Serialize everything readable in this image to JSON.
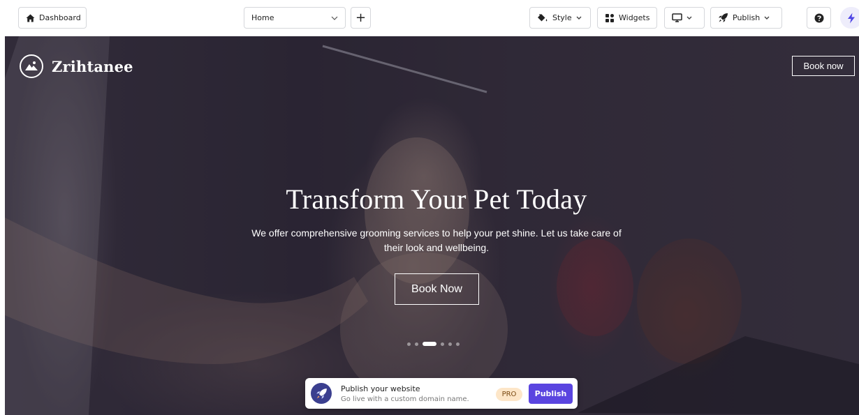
{
  "toolbar": {
    "dashboard_label": "Dashboard",
    "page_select_value": "Home",
    "add_page_label": "+",
    "style_label": "Style",
    "widgets_label": "Widgets",
    "publish_label": "Publish",
    "icons": [
      "home-icon",
      "chevron-down-icon",
      "plus-icon",
      "paint-bucket-icon",
      "widgets-grid-icon",
      "monitor-icon",
      "rocket-icon",
      "help-icon",
      "lightning-icon"
    ]
  },
  "site": {
    "brand_name": "Zrihtanee",
    "nav_cta": "Book now",
    "hero": {
      "title": "Transform Your Pet Today",
      "subtitle": "We offer comprehensive grooming services to help your pet shine. Let us take care of their look and wellbeing.",
      "cta": "Book Now",
      "slides_count": 6,
      "active_slide": 3
    }
  },
  "publish_banner": {
    "title": "Publish your website",
    "subtitle": "Go live with a custom domain name.",
    "badge": "PRO",
    "button": "Publish"
  },
  "colors": {
    "accent": "#5a45e0",
    "pro_badge_bg": "#fde6c8",
    "rocket_badge_bg": "#3b3f8f"
  }
}
